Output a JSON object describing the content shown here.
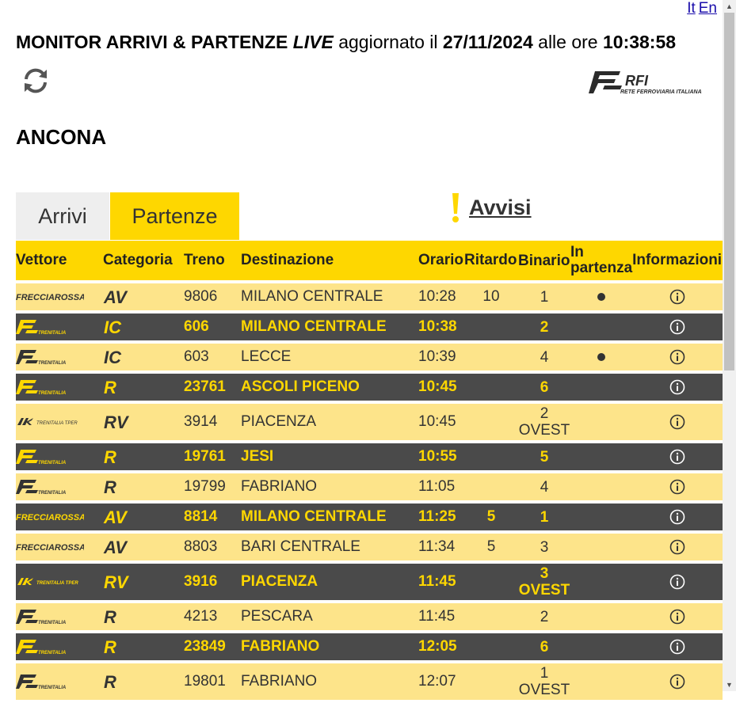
{
  "lang": {
    "it": "It",
    "en": "En"
  },
  "header": {
    "title": "MONITOR ARRIVI & PARTENZE",
    "live": "LIVE",
    "updated_prefix": "aggiornato il",
    "date": "27/11/2024",
    "time_prefix": "alle ore",
    "time": "10:38:58"
  },
  "brand": {
    "name": "RFI",
    "subtitle": "RETE FERROVIARIA ITALIANA"
  },
  "station": "ANCONA",
  "tabs": {
    "arrivi": "Arrivi",
    "partenze": "Partenze",
    "active": "Partenze"
  },
  "avvisi": "Avvisi",
  "table": {
    "headers": {
      "vettore": "Vettore",
      "categoria": "Categoria",
      "treno": "Treno",
      "destinazione": "Destinazione",
      "orario": "Orario",
      "ritardo": "Ritardo",
      "binario": "Binario",
      "in_partenza_1": "In",
      "in_partenza_2": "partenza",
      "informazioni": "Informazioni"
    },
    "rows": [
      {
        "vettore": "FRECCIAROSSA",
        "categoria": "AV",
        "treno": "9806",
        "destinazione": "MILANO CENTRALE",
        "orario": "10:28",
        "ritardo": "10",
        "binario": "1",
        "binario2": "",
        "in_partenza": true
      },
      {
        "vettore": "TRENITALIA",
        "categoria": "IC",
        "treno": "606",
        "destinazione": "MILANO CENTRALE",
        "orario": "10:38",
        "ritardo": "",
        "binario": "2",
        "binario2": "",
        "in_partenza": false
      },
      {
        "vettore": "TRENITALIA",
        "categoria": "IC",
        "treno": "603",
        "destinazione": "LECCE",
        "orario": "10:39",
        "ritardo": "",
        "binario": "4",
        "binario2": "",
        "in_partenza": true
      },
      {
        "vettore": "TRENITALIA",
        "categoria": "R",
        "treno": "23761",
        "destinazione": "ASCOLI PICENO",
        "orario": "10:45",
        "ritardo": "",
        "binario": "6",
        "binario2": "",
        "in_partenza": false
      },
      {
        "vettore": "TRENITALIA TPER",
        "categoria": "RV",
        "treno": "3914",
        "destinazione": "PIACENZA",
        "orario": "10:45",
        "ritardo": "",
        "binario": "2",
        "binario2": "OVEST",
        "in_partenza": false
      },
      {
        "vettore": "TRENITALIA",
        "categoria": "R",
        "treno": "19761",
        "destinazione": "JESI",
        "orario": "10:55",
        "ritardo": "",
        "binario": "5",
        "binario2": "",
        "in_partenza": false
      },
      {
        "vettore": "TRENITALIA",
        "categoria": "R",
        "treno": "19799",
        "destinazione": "FABRIANO",
        "orario": "11:05",
        "ritardo": "",
        "binario": "4",
        "binario2": "",
        "in_partenza": false
      },
      {
        "vettore": "FRECCIAROSSA",
        "categoria": "AV",
        "treno": "8814",
        "destinazione": "MILANO CENTRALE",
        "orario": "11:25",
        "ritardo": "5",
        "binario": "1",
        "binario2": "",
        "in_partenza": false
      },
      {
        "vettore": "FRECCIAROSSA",
        "categoria": "AV",
        "treno": "8803",
        "destinazione": "BARI CENTRALE",
        "orario": "11:34",
        "ritardo": "5",
        "binario": "3",
        "binario2": "",
        "in_partenza": false
      },
      {
        "vettore": "TRENITALIA TPER",
        "categoria": "RV",
        "treno": "3916",
        "destinazione": "PIACENZA",
        "orario": "11:45",
        "ritardo": "",
        "binario": "3",
        "binario2": "OVEST",
        "in_partenza": false
      },
      {
        "vettore": "TRENITALIA",
        "categoria": "R",
        "treno": "4213",
        "destinazione": "PESCARA",
        "orario": "11:45",
        "ritardo": "",
        "binario": "2",
        "binario2": "",
        "in_partenza": false
      },
      {
        "vettore": "TRENITALIA",
        "categoria": "R",
        "treno": "23849",
        "destinazione": "FABRIANO",
        "orario": "12:05",
        "ritardo": "",
        "binario": "6",
        "binario2": "",
        "in_partenza": false
      },
      {
        "vettore": "TRENITALIA",
        "categoria": "R",
        "treno": "19801",
        "destinazione": "FABRIANO",
        "orario": "12:07",
        "ritardo": "",
        "binario": "1",
        "binario2": "OVEST",
        "in_partenza": false
      }
    ]
  },
  "colors": {
    "accent": "#fed700",
    "row_light": "#fde48a",
    "row_dark": "#4a4a4a"
  }
}
